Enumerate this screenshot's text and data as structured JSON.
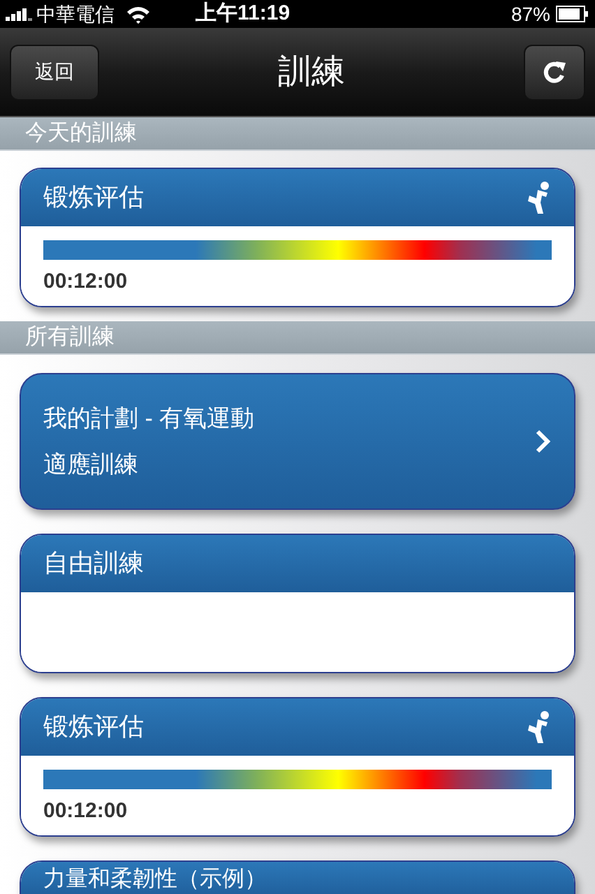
{
  "status_bar": {
    "carrier": "中華電信",
    "time": "上午11:19",
    "battery": "87%"
  },
  "nav": {
    "back": "返回",
    "title": "訓練"
  },
  "sections": [
    {
      "title": "今天的訓練",
      "cards": [
        {
          "kind": "meter",
          "title": "锻炼评估",
          "time": "00:12:00"
        }
      ]
    },
    {
      "title": "所有訓練",
      "cards": [
        {
          "kind": "link",
          "title": "我的計劃 - 有氧運動",
          "subtitle": "適應訓練"
        },
        {
          "kind": "empty",
          "title": "自由訓練"
        },
        {
          "kind": "meter",
          "title": "锻炼评估",
          "time": "00:12:00"
        },
        {
          "kind": "cut",
          "title": "力量和柔韌性（示例）"
        }
      ]
    }
  ]
}
